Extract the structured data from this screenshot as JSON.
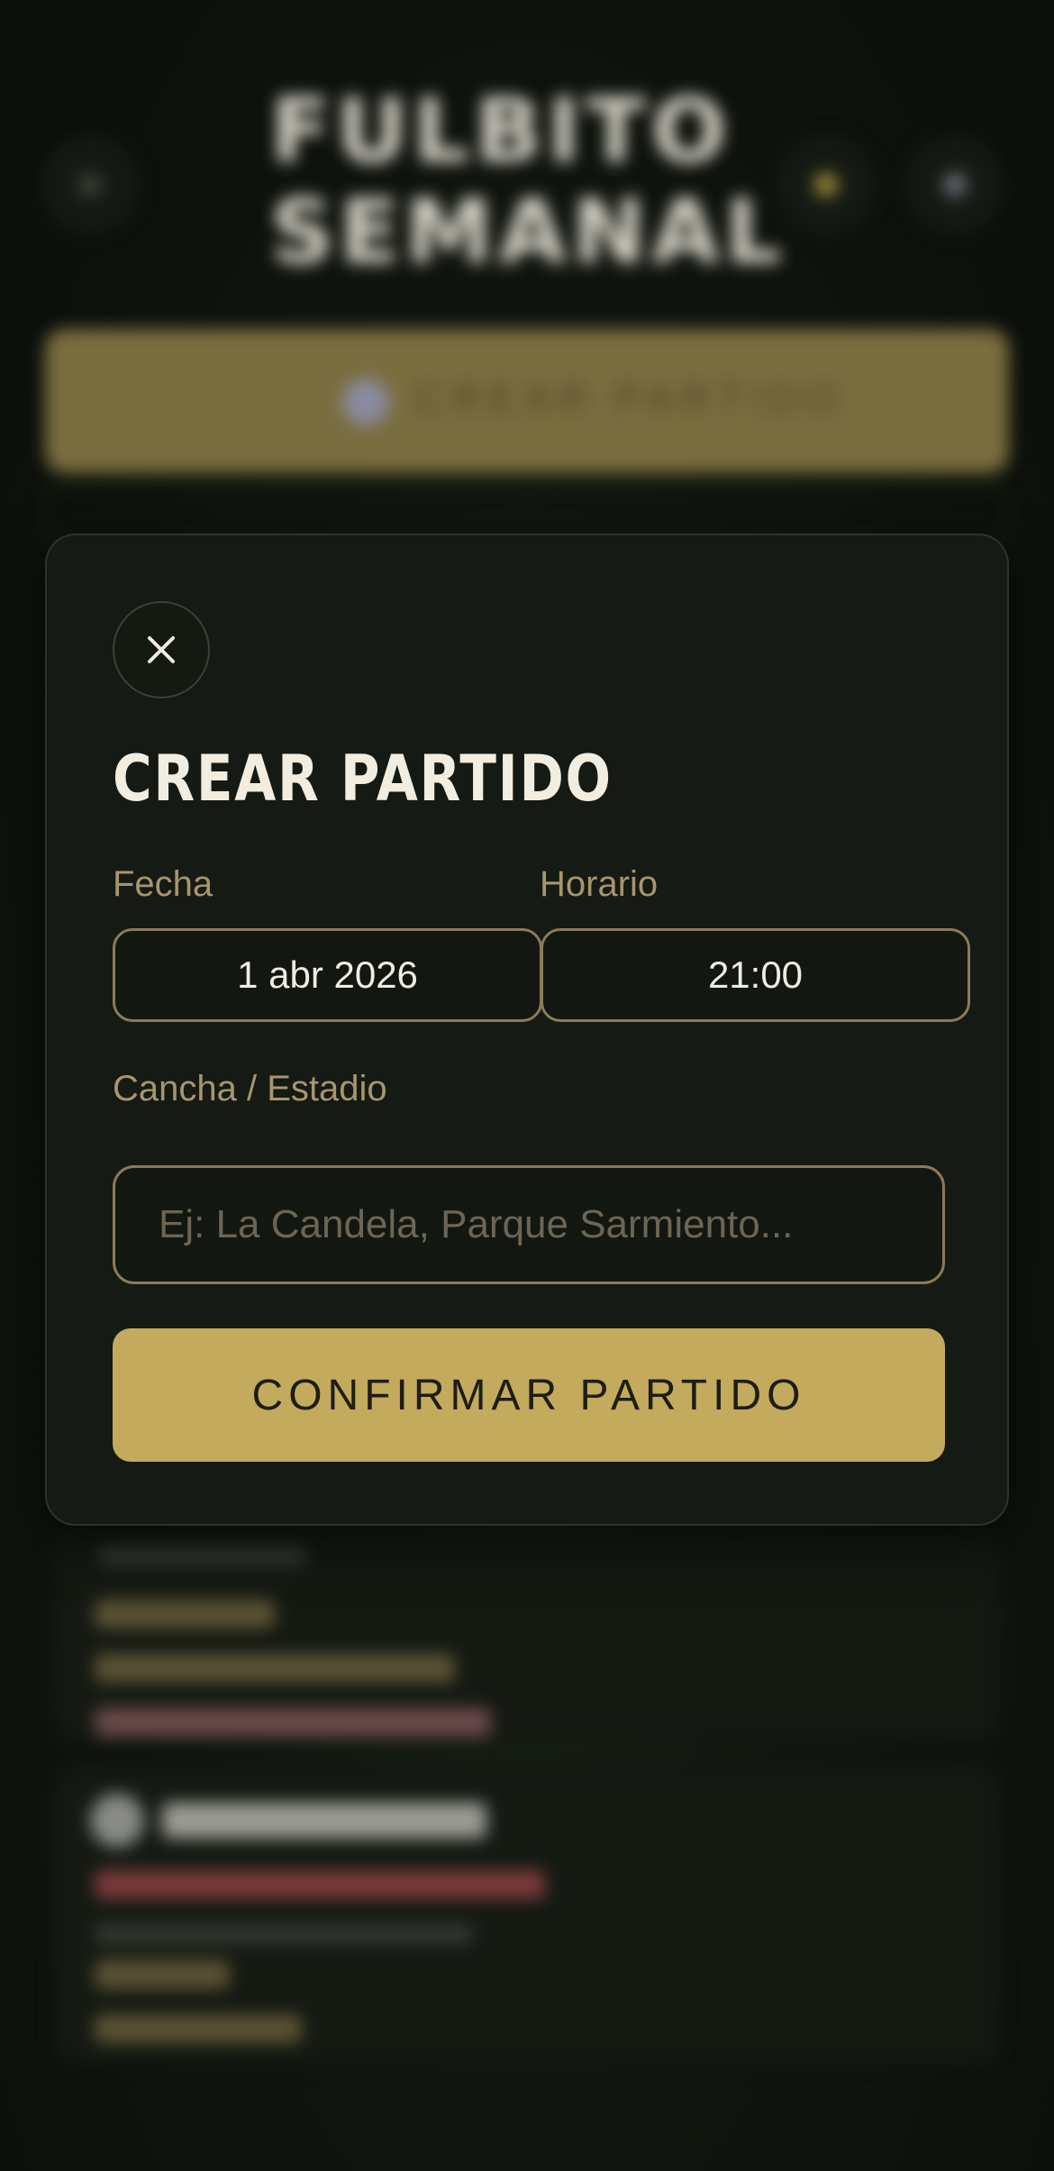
{
  "background": {
    "app_title": "FULBITO SEMANAL",
    "create_button_label": "CREAR PARTIDO"
  },
  "modal": {
    "title": "CREAR PARTIDO",
    "date_label": "Fecha",
    "date_value": "1 abr 2026",
    "time_label": "Horario",
    "time_value": "21:00",
    "venue_label": "Cancha / Estadio",
    "venue_placeholder": "Ej: La Candela, Parque Sarmiento...",
    "venue_value": "",
    "confirm_label": "CONFIRMAR PARTIDO"
  },
  "colors": {
    "accent": "#c4aa5c",
    "field_border": "#8c7a57",
    "label": "#a8956e",
    "modal_bg": "#151a14"
  },
  "icons": {
    "close": "close-icon"
  }
}
